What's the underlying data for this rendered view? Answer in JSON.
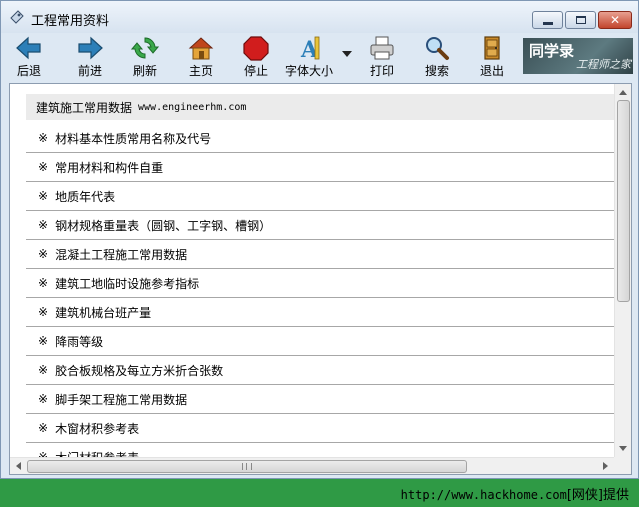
{
  "window": {
    "title": "工程常用资料",
    "controls": {
      "minimize": "minimize",
      "maximize": "maximize",
      "close": "✕"
    }
  },
  "toolbar": {
    "buttons": [
      {
        "label": "后退",
        "icon": "back-arrow-icon"
      },
      {
        "label": "前进",
        "icon": "forward-arrow-icon"
      },
      {
        "label": "刷新",
        "icon": "refresh-icon"
      },
      {
        "label": "主页",
        "icon": "home-icon"
      },
      {
        "label": "停止",
        "icon": "stop-icon"
      },
      {
        "label": "字体大小",
        "icon": "font-size-icon"
      },
      {
        "label": "打印",
        "icon": "printer-icon"
      },
      {
        "label": "搜索",
        "icon": "search-icon"
      },
      {
        "label": "退出",
        "icon": "exit-door-icon"
      }
    ],
    "brand": {
      "main": "同学录",
      "sub": "工程师之家"
    }
  },
  "content": {
    "header_text": "建筑施工常用数据",
    "header_url": "www.engineerhm.com",
    "bullet": "※",
    "items": [
      "材料基本性质常用名称及代号",
      "常用材料和构件自重",
      "地质年代表",
      "钢材规格重量表（圆钢、工字钢、槽钢）",
      "混凝土工程施工常用数据",
      "建筑工地临时设施参考指标",
      "建筑机械台班产量",
      "降雨等级",
      "胶合板规格及每立方米折合张数",
      "脚手架工程施工常用数据",
      "木窗材积参考表",
      "木门材积参考表"
    ]
  },
  "footer": {
    "url": "http://www.hackhome.com",
    "suffix": "[网侠]提供"
  },
  "colors": {
    "footer_green": "#2f9a45",
    "window_bg": "#dde8f3",
    "close_red": "#c2452d"
  }
}
